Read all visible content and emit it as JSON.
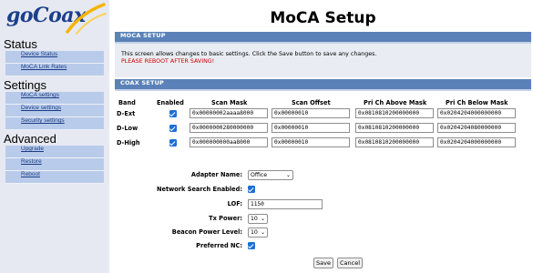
{
  "brand": {
    "logo_text": "goCoax"
  },
  "sidebar": {
    "sections": [
      {
        "title": "Status",
        "items": [
          "Device Status",
          "MoCA Link Rates"
        ]
      },
      {
        "title": "Settings",
        "items": [
          "MoCA settings",
          "Device settings",
          "Security settings"
        ]
      },
      {
        "title": "Advanced",
        "items": [
          "Upgrade",
          "Restore",
          "Reboot"
        ]
      }
    ]
  },
  "page": {
    "title": "MoCA Setup"
  },
  "moca_panel": {
    "header": "MOCA SETUP",
    "description": "This screen allows changes to basic settings. Click the Save button to save any changes.",
    "warning": "PLEASE REBOOT AFTER SAVING!"
  },
  "coax_panel": {
    "header": "COAX SETUP",
    "columns": [
      "Band",
      "Enabled",
      "Scan Mask",
      "Scan Offset",
      "Pri Ch Above Mask",
      "Pri Ch Below Mask"
    ],
    "bands": [
      {
        "name": "D-Ext",
        "enabled": true,
        "scan_mask": "0x00000002aaaa8000",
        "scan_offset": "0x00000010",
        "above_mask": "0x0810810200000000",
        "below_mask": "0x0204204000000000"
      },
      {
        "name": "D-Low",
        "enabled": true,
        "scan_mask": "0x0000000280000000",
        "scan_offset": "0x00000010",
        "above_mask": "0x0810810200000000",
        "below_mask": "0x0204204080000000"
      },
      {
        "name": "D-High",
        "enabled": true,
        "scan_mask": "0x000000000aa8000",
        "scan_offset": "0x00000010",
        "above_mask": "0x0810810200000000",
        "below_mask": "0x0204204000000000"
      }
    ],
    "form": {
      "adapter_name_label": "Adapter Name:",
      "adapter_name_value": "Office",
      "network_search_label": "Network Search Enabled:",
      "network_search_enabled": true,
      "lof_label": "LOF:",
      "lof_value": "1150",
      "tx_power_label": "Tx Power:",
      "tx_power_value": "10",
      "beacon_power_label": "Beacon Power Level:",
      "beacon_power_value": "10",
      "preferred_nc_label": "Preferred NC:",
      "preferred_nc_enabled": true
    },
    "buttons": {
      "save": "Save",
      "cancel": "Cancel"
    }
  },
  "colors": {
    "panel_header": "#5a82b8",
    "nav_item": "#b9cbea",
    "logo": "#1b3f8c",
    "warning": "#d00000",
    "checkbox": "#1d6fd6"
  }
}
